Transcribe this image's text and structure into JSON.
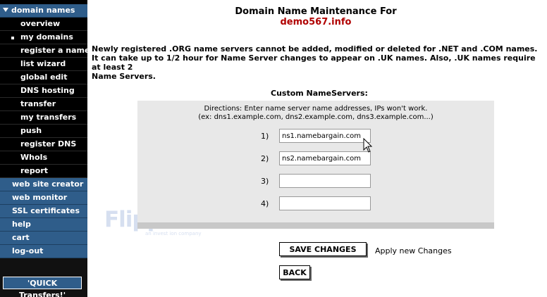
{
  "sidebar": {
    "items": [
      {
        "label": "domain names",
        "kind": "blue-expanded"
      },
      {
        "label": "overview",
        "kind": "sub"
      },
      {
        "label": "my domains",
        "kind": "sub-active"
      },
      {
        "label": "register a name",
        "kind": "sub"
      },
      {
        "label": "list wizard",
        "kind": "sub"
      },
      {
        "label": "global edit",
        "kind": "sub"
      },
      {
        "label": "DNS hosting",
        "kind": "sub"
      },
      {
        "label": "transfer",
        "kind": "sub"
      },
      {
        "label": "my transfers",
        "kind": "sub"
      },
      {
        "label": "push",
        "kind": "sub"
      },
      {
        "label": "register DNS",
        "kind": "sub"
      },
      {
        "label": "WhoIs",
        "kind": "sub"
      },
      {
        "label": "report",
        "kind": "sub"
      },
      {
        "label": "web site creator",
        "kind": "blue"
      },
      {
        "label": "web monitor",
        "kind": "blue"
      },
      {
        "label": "SSL certificates",
        "kind": "blue"
      },
      {
        "label": "help",
        "kind": "blue"
      },
      {
        "label": "cart",
        "kind": "blue"
      },
      {
        "label": "log-out",
        "kind": "blue"
      }
    ],
    "quick_transfers": "'QUICK Transfers!'"
  },
  "main": {
    "title": "Domain Name Maintenance For",
    "domain": "demo567.info",
    "notice_lines": [
      "Newly registered .ORG name servers cannot be added, modified or deleted for .NET and .COM names.",
      "It can take up to 1/2 hour for Name Server changes to appear on .UK names. Also, .UK names require at least 2",
      "Name Servers."
    ],
    "custom_title": "Custom NameServers:",
    "directions": [
      "Directions: Enter name server name addresses, IPs won't work.",
      "(ex: dns1.example.com, dns2.example.com, dns3.example.com...)"
    ],
    "nameservers": [
      {
        "num": "1)",
        "value": "ns1.namebargain.com"
      },
      {
        "num": "2)",
        "value": "ns2.namebargain.com"
      },
      {
        "num": "3)",
        "value": ""
      },
      {
        "num": "4)",
        "value": ""
      }
    ],
    "save_button": "SAVE CHANGES",
    "apply_label": "Apply new Changes",
    "back_button": "BACK"
  },
  "watermark": {
    "brand": "FlipperHost",
    "tagline": "an invest ion company"
  },
  "colors": {
    "sidebar_blue": "#2f5d8a",
    "domain_red": "#b00000",
    "panel_gray": "#e8e8e8"
  }
}
